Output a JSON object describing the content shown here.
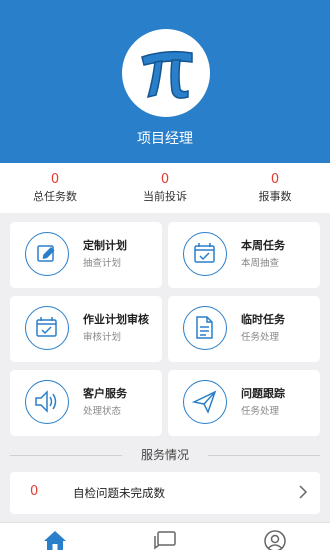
{
  "profile": {
    "role": "项目经理",
    "logo_icon": "pi-logo-icon"
  },
  "stats": [
    {
      "value": "0",
      "label": "总任务数"
    },
    {
      "value": "0",
      "label": "当前投诉"
    },
    {
      "value": "0",
      "label": "报事数"
    }
  ],
  "cards": [
    {
      "title": "定制计划",
      "subtitle": "抽查计划",
      "icon": "edit-icon"
    },
    {
      "title": "本周任务",
      "subtitle": "本周抽查",
      "icon": "calendar-check-icon"
    },
    {
      "title": "作业计划审核",
      "subtitle": "审核计划",
      "icon": "calendar-check-icon"
    },
    {
      "title": "临时任务",
      "subtitle": "任务处理",
      "icon": "document-icon"
    },
    {
      "title": "客户服务",
      "subtitle": "处理状态",
      "icon": "speaker-icon"
    },
    {
      "title": "问题跟踪",
      "subtitle": "任务处理",
      "icon": "paper-plane-icon"
    }
  ],
  "section": {
    "title": "服务情况"
  },
  "service_rows": [
    {
      "count": "0",
      "label": "自检问题未完成数"
    }
  ],
  "tabbar": [
    {
      "icon": "home-icon",
      "active": true
    },
    {
      "icon": "message-icon",
      "active": false
    },
    {
      "icon": "user-icon",
      "active": false
    }
  ],
  "colors": {
    "primary": "#2a7fca",
    "alert": "#e23b33",
    "background": "#efeff1"
  }
}
